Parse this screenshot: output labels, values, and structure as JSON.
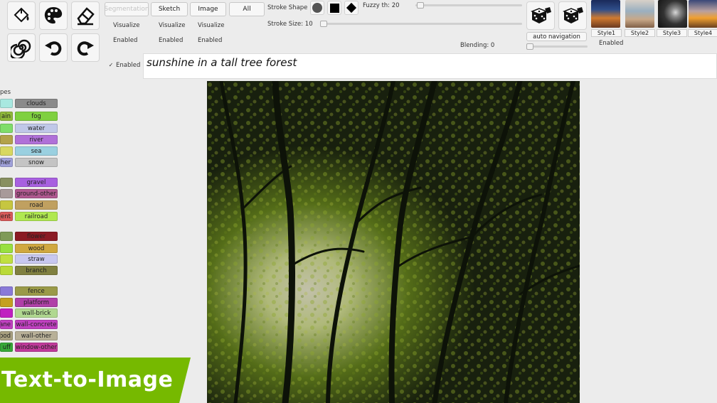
{
  "toolbar": {
    "tools": [
      "paint-bucket-icon",
      "palette-icon",
      "eraser-icon",
      "spiral-icon",
      "undo-icon",
      "redo-icon"
    ],
    "modes": {
      "segmentation": "Segmentation",
      "sketch": "Sketch",
      "image": "Image",
      "all": "All"
    },
    "visualize_label": "Visualize",
    "enabled_label": "Enabled"
  },
  "stroke": {
    "shape_label": "Stroke Shape",
    "size_label": "Stroke Size: 10",
    "fuzzy_label": "Fuzzy th: 20",
    "blending_label": "Blending: 0",
    "shapes": [
      "circle-shape",
      "square-shape",
      "diamond-shape"
    ]
  },
  "navigation": {
    "auto_label": "auto navigation",
    "enabled_label": "Enabled"
  },
  "styles": [
    "Style1",
    "Style2",
    "Style3",
    "Style4"
  ],
  "prompt": {
    "enabled_label": "Enabled",
    "text": "sunshine in a tall tree forest"
  },
  "palette": {
    "section_title": "pes",
    "left": [
      {
        "label": "",
        "color": "#a8e8e0"
      },
      {
        "label": "ain",
        "color": "#8fb83a"
      },
      {
        "label": "",
        "color": "#7fdd6a"
      },
      {
        "label": "",
        "color": "#b3a24a"
      },
      {
        "label": "",
        "color": "#d8d860"
      },
      {
        "label": "her",
        "color": "#9fa0d8"
      },
      {
        "label": "",
        "color": "#889060"
      },
      {
        "label": "",
        "color": "#a89a9a"
      },
      {
        "label": "",
        "color": "#c6c640"
      },
      {
        "label": "ent",
        "color": "#d85a5a"
      },
      {
        "label": "",
        "color": "#7f9a58"
      },
      {
        "label": "",
        "color": "#98e040"
      },
      {
        "label": "",
        "color": "#c0e040"
      },
      {
        "label": "",
        "color": "#bada38"
      },
      {
        "label": "",
        "color": "#8a7ad8"
      },
      {
        "label": "",
        "color": "#c4a020"
      },
      {
        "label": "",
        "color": "#c020c0"
      },
      {
        "label": "ane",
        "color": "#c040c0"
      },
      {
        "label": "ood",
        "color": "#a8a080"
      },
      {
        "label": "uff",
        "color": "#38a838"
      }
    ],
    "right": [
      {
        "label": "clouds",
        "color": "#8a8a8a"
      },
      {
        "label": "fog",
        "color": "#7fd040"
      },
      {
        "label": "water",
        "color": "#c0c8e8"
      },
      {
        "label": "river",
        "color": "#b070d8"
      },
      {
        "label": "sea",
        "color": "#9ad0e0"
      },
      {
        "label": "snow",
        "color": "#c4c4c4"
      },
      {
        "label": "gravel",
        "color": "#a860e0"
      },
      {
        "label": "ground-other",
        "color": "#b05890"
      },
      {
        "label": "road",
        "color": "#c0a060"
      },
      {
        "label": "railroad",
        "color": "#b0e850"
      },
      {
        "label": "flower",
        "color": "#8a1a24"
      },
      {
        "label": "wood",
        "color": "#d0a840"
      },
      {
        "label": "straw",
        "color": "#c8c8f0"
      },
      {
        "label": "branch",
        "color": "#808040"
      },
      {
        "label": "fence",
        "color": "#9a9a48"
      },
      {
        "label": "platform",
        "color": "#b040a8"
      },
      {
        "label": "wall-brick",
        "color": "#b0d890"
      },
      {
        "label": "wall-concrete",
        "color": "#c040c0"
      },
      {
        "label": "wall-other",
        "color": "#b8b098"
      },
      {
        "label": "window-other",
        "color": "#c03a9a"
      }
    ]
  },
  "banner": {
    "text": "Text-to-Image",
    "color": "#76b900"
  }
}
